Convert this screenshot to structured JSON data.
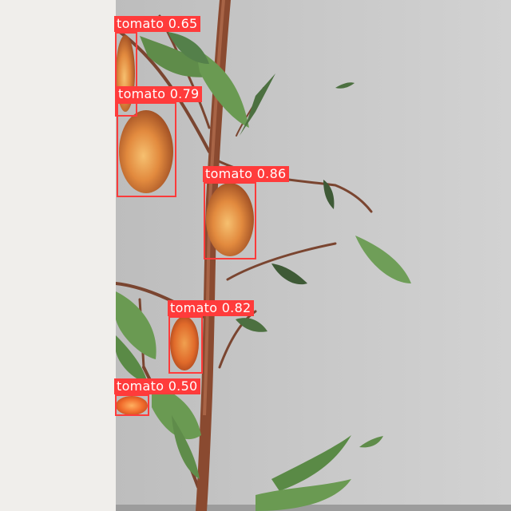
{
  "detections": [
    {
      "class": "tomato",
      "confidence": "0.65",
      "label": "tomato  0.65"
    },
    {
      "class": "tomato",
      "confidence": "0.79",
      "label": "tomato  0.79"
    },
    {
      "class": "tomato",
      "confidence": "0.86",
      "label": "tomato  0.86"
    },
    {
      "class": "tomato",
      "confidence": "0.82",
      "label": "tomato  0.82"
    },
    {
      "class": "tomato",
      "confidence": "0.50",
      "label": "tomato  0.50"
    }
  ],
  "colors": {
    "box": "#ff3b3b",
    "label_text": "#ffffff",
    "background_wall": "#c6c6c6",
    "margin": "#f0eeeb",
    "stem": "#8a4a30",
    "leaf": "#5f8c4a",
    "fruit": "#e08840"
  }
}
